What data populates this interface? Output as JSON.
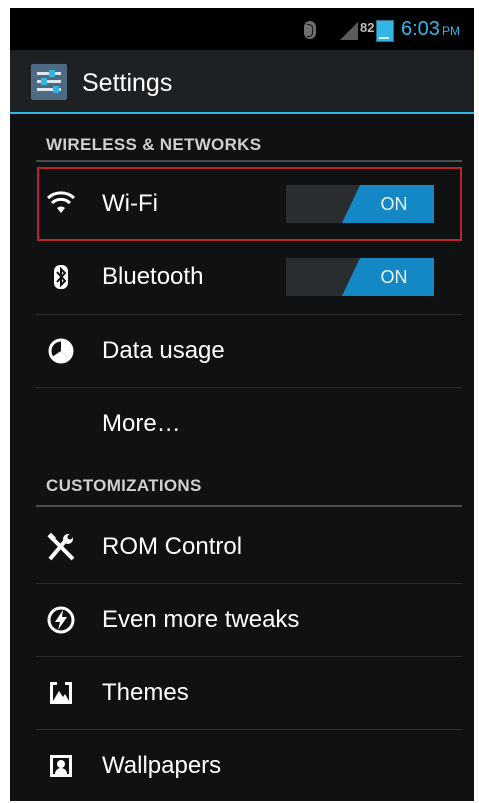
{
  "status_bar": {
    "battery_level": "82",
    "time": "6:03",
    "ampm": "PM"
  },
  "action_bar": {
    "title": "Settings",
    "icon": "settings-sliders-icon"
  },
  "sections": [
    {
      "header": "WIRELESS & NETWORKS",
      "items": [
        {
          "label": "Wi-Fi",
          "icon": "wifi-icon",
          "toggle": "ON"
        },
        {
          "label": "Bluetooth",
          "icon": "bluetooth-icon",
          "toggle": "ON"
        },
        {
          "label": "Data usage",
          "icon": "data-usage-icon"
        },
        {
          "label": "More…"
        }
      ]
    },
    {
      "header": "CUSTOMIZATIONS",
      "items": [
        {
          "label": "ROM Control",
          "icon": "tools-icon"
        },
        {
          "label": "Even more tweaks",
          "icon": "lightning-icon"
        },
        {
          "label": "Themes",
          "icon": "themes-icon"
        },
        {
          "label": "Wallpapers",
          "icon": "wallpapers-icon"
        }
      ]
    }
  ],
  "colors": {
    "accent": "#33b5e5",
    "toggle_on": "#1488c4",
    "highlight_border": "#b8262c",
    "background": "#0f1113"
  }
}
